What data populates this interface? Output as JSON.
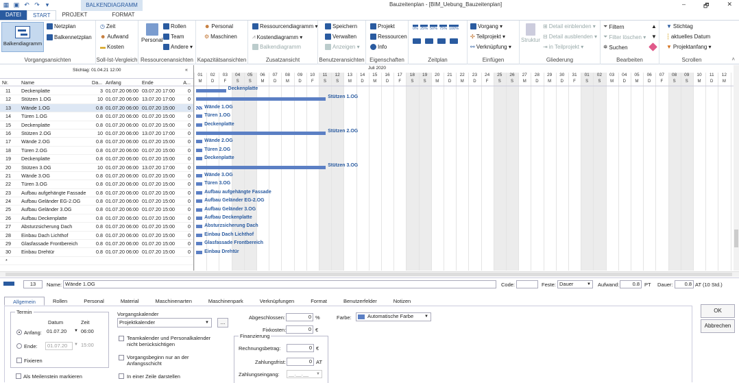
{
  "window": {
    "title": "Bauzeitenplan - [BIM_Uebung_Bauzeitenplan]",
    "context_tab": "BALKENDIAGRAMM",
    "minimize": "–",
    "restore": "🗗",
    "close": "✕"
  },
  "tabs": [
    {
      "label": "DATEI"
    },
    {
      "label": "START"
    },
    {
      "label": "PROJEKT"
    },
    {
      "label": "FORMAT"
    }
  ],
  "ribbon": {
    "g1": {
      "label": "Vorgangsansichten",
      "big": "Balkendiagramm",
      "items": [
        "Netzplan",
        "Balkennetzplan"
      ]
    },
    "g2": {
      "label": "Soll-Ist-Vergleich",
      "items": [
        "Zeit",
        "Aufwand",
        "Kosten"
      ]
    },
    "g3": {
      "label": "Ressourcenansichten",
      "big": "Personal",
      "items": [
        "Rollen",
        "Team",
        "Andere ▾"
      ]
    },
    "g4": {
      "label": "Kapazitätsansichten",
      "items": [
        "Personal",
        "Maschinen"
      ]
    },
    "g5": {
      "label": "Zusatzansicht",
      "items": [
        "Ressourcendiagramm ▾",
        "Kostendiagramm ▾",
        "Balkendiagramm"
      ]
    },
    "g6": {
      "label": "Benutzeransichten",
      "items": [
        "Speichern",
        "Verwalten",
        "Anzeigen ▾"
      ]
    },
    "g7": {
      "label": "Eigenschaften",
      "items": [
        "Projekt",
        "Ressourcen",
        "Info"
      ]
    },
    "g8": {
      "label": "Zeitplan",
      "zooms": [
        "0%",
        "25%",
        "50%",
        "75%",
        "100%"
      ]
    },
    "g9": {
      "label": "Einfügen",
      "items": [
        "Vorgang ▾",
        "Teilprojekt ▾",
        "Verknüpfung ▾"
      ]
    },
    "g10": {
      "label": "Gliederung",
      "big": "Struktur",
      "items": [
        "Detail einblenden ▾",
        "Detail ausblenden ▾",
        "in Teilprojekt ▾"
      ]
    },
    "g11": {
      "label": "Bearbeiten",
      "items": [
        "Filtern",
        "Filter löschen ▾",
        "Suchen"
      ]
    },
    "g12": {
      "label": "Scrollen",
      "items": [
        "Stichtag",
        "aktuelles Datum",
        "Projektanfang ▾"
      ]
    }
  },
  "table": {
    "stichtag": "Stichtag: 01.04.21 12:00",
    "collapse": "«",
    "columns": [
      "Nr.",
      "Name",
      "Da...",
      "Anfang",
      "Ende",
      "A..."
    ],
    "rows": [
      {
        "nr": "11",
        "name": "Deckenplatte",
        "dau": "3",
        "anf": "01.07.20 06:00",
        "end": "03.07.20 17:00",
        "a": "0"
      },
      {
        "nr": "12",
        "name": "Stützen 1.OG",
        "dau": "10",
        "anf": "01.07.20 06:00",
        "end": "13.07.20 17:00",
        "a": "0"
      },
      {
        "nr": "13",
        "name": "Wände 1.OG",
        "dau": "0.8",
        "anf": "01.07.20 06:00",
        "end": "01.07.20 15:00",
        "a": "0"
      },
      {
        "nr": "14",
        "name": "Türen 1.OG",
        "dau": "0.8",
        "anf": "01.07.20 06:00",
        "end": "01.07.20 15:00",
        "a": "0"
      },
      {
        "nr": "15",
        "name": "Deckenplatte",
        "dau": "0.8",
        "anf": "01.07.20 06:00",
        "end": "01.07.20 15:00",
        "a": "0"
      },
      {
        "nr": "16",
        "name": "Stützen 2.OG",
        "dau": "10",
        "anf": "01.07.20 06:00",
        "end": "13.07.20 17:00",
        "a": "0"
      },
      {
        "nr": "17",
        "name": "Wände 2.OG",
        "dau": "0.8",
        "anf": "01.07.20 06:00",
        "end": "01.07.20 15:00",
        "a": "0"
      },
      {
        "nr": "18",
        "name": "Türen 2.OG",
        "dau": "0.8",
        "anf": "01.07.20 06:00",
        "end": "01.07.20 15:00",
        "a": "0"
      },
      {
        "nr": "19",
        "name": "Deckenplatte",
        "dau": "0.8",
        "anf": "01.07.20 06:00",
        "end": "01.07.20 15:00",
        "a": "0"
      },
      {
        "nr": "20",
        "name": "Stützen 3.OG",
        "dau": "10",
        "anf": "01.07.20 06:00",
        "end": "13.07.20 17:00",
        "a": "0"
      },
      {
        "nr": "21",
        "name": "Wände 3.OG",
        "dau": "0.8",
        "anf": "01.07.20 06:00",
        "end": "01.07.20 15:00",
        "a": "0"
      },
      {
        "nr": "22",
        "name": "Türen 3.OG",
        "dau": "0.8",
        "anf": "01.07.20 06:00",
        "end": "01.07.20 15:00",
        "a": "0"
      },
      {
        "nr": "23",
        "name": "Aufbau aufgehängte Fassade",
        "dau": "0.8",
        "anf": "01.07.20 06:00",
        "end": "01.07.20 15:00",
        "a": "0"
      },
      {
        "nr": "24",
        "name": "Aufbau Geländer EG-2.OG",
        "dau": "0.8",
        "anf": "01.07.20 06:00",
        "end": "01.07.20 15:00",
        "a": "0"
      },
      {
        "nr": "25",
        "name": "Aufbau Geländer 3.OG",
        "dau": "0.8",
        "anf": "01.07.20 06:00",
        "end": "01.07.20 15:00",
        "a": "0"
      },
      {
        "nr": "26",
        "name": "Aufbau Deckenplatte",
        "dau": "0.8",
        "anf": "01.07.20 06:00",
        "end": "01.07.20 15:00",
        "a": "0"
      },
      {
        "nr": "27",
        "name": "Absturzsicherung Dach",
        "dau": "0.8",
        "anf": "01.07.20 06:00",
        "end": "01.07.20 15:00",
        "a": "0"
      },
      {
        "nr": "28",
        "name": "Einbau Dach Lichthof",
        "dau": "0.8",
        "anf": "01.07.20 06:00",
        "end": "01.07.20 15:00",
        "a": "0"
      },
      {
        "nr": "29",
        "name": "Glasfassade Frontbereich",
        "dau": "0.8",
        "anf": "01.07.20 06:00",
        "end": "01.07.20 15:00",
        "a": "0"
      },
      {
        "nr": "30",
        "name": "Einbau Drehtür",
        "dau": "0.8",
        "anf": "01.07.20 06:00",
        "end": "01.07.20 15:00",
        "a": "0"
      },
      {
        "nr": "*",
        "name": "",
        "dau": "",
        "anf": "",
        "end": "",
        "a": ""
      }
    ]
  },
  "gantt": {
    "month": "Juli 2020",
    "days": [
      "01",
      "02",
      "03",
      "04",
      "05",
      "06",
      "07",
      "08",
      "09",
      "10",
      "11",
      "12",
      "13",
      "14",
      "15",
      "16",
      "17",
      "18",
      "19",
      "20",
      "21",
      "22",
      "23",
      "24",
      "25",
      "26",
      "27",
      "28",
      "29",
      "30",
      "31",
      "01",
      "02",
      "03",
      "04",
      "05",
      "06",
      "07",
      "08",
      "09",
      "10",
      "11",
      "12",
      "13"
    ],
    "weekday_letters": [
      "M",
      "D",
      "F",
      "S",
      "S",
      "M",
      "D",
      "M",
      "D",
      "F",
      "S",
      "S",
      "M",
      "D",
      "M",
      "D",
      "F",
      "S",
      "S",
      "M",
      "D",
      "M",
      "D",
      "F",
      "S",
      "S",
      "M",
      "D",
      "M",
      "D",
      "F",
      "S",
      "S",
      "M",
      "D",
      "M",
      "D",
      "F",
      "S",
      "S",
      "M",
      "D",
      "M",
      "D"
    ],
    "weekend_indices": [
      3,
      4,
      10,
      11,
      17,
      18,
      24,
      25,
      31,
      32,
      38,
      39
    ],
    "bars": [
      {
        "label": "Deckenplatte",
        "start_day": 0,
        "duration_days": 2.4
      },
      {
        "label": "Stützen 1.OG",
        "start_day": 0,
        "duration_days": 10.4
      },
      {
        "label": "Wände 1.OG",
        "start_day": 0,
        "duration_days": 0.5
      },
      {
        "label": "Türen 1.OG",
        "start_day": 0,
        "duration_days": 0.5
      },
      {
        "label": "Deckenplatte",
        "start_day": 0,
        "duration_days": 0.5
      },
      {
        "label": "Stützen 2.OG",
        "start_day": 0,
        "duration_days": 10.4
      },
      {
        "label": "Wände 2.OG",
        "start_day": 0,
        "duration_days": 0.5
      },
      {
        "label": "Türen 2.OG",
        "start_day": 0,
        "duration_days": 0.5
      },
      {
        "label": "Deckenplatte",
        "start_day": 0,
        "duration_days": 0.5
      },
      {
        "label": "Stützen 3.OG",
        "start_day": 0,
        "duration_days": 10.4
      },
      {
        "label": "Wände 3.OG",
        "start_day": 0,
        "duration_days": 0.5
      },
      {
        "label": "Türen 3.OG",
        "start_day": 0,
        "duration_days": 0.5
      },
      {
        "label": "Aufbau aufgehängte Fassade",
        "start_day": 0,
        "duration_days": 0.5
      },
      {
        "label": "Aufbau Geländer EG-2.OG",
        "start_day": 0,
        "duration_days": 0.5
      },
      {
        "label": "Aufbau Geländer 3.OG",
        "start_day": 0,
        "duration_days": 0.5
      },
      {
        "label": "Aufbau Deckenplatte",
        "start_day": 0,
        "duration_days": 0.5
      },
      {
        "label": "Absturzsicherung Dach",
        "start_day": 0,
        "duration_days": 0.5
      },
      {
        "label": "Einbau Dach Lichthof",
        "start_day": 0,
        "duration_days": 0.5
      },
      {
        "label": "Glasfassade Frontbereich",
        "start_day": 0,
        "duration_days": 0.5
      },
      {
        "label": "Einbau Drehtür",
        "start_day": 0,
        "duration_days": 0.5
      }
    ]
  },
  "detail": {
    "nr": "13",
    "name_label": "Name:",
    "name": "Wände 1.OG",
    "code_label": "Code:",
    "code": "",
    "feste_label": "Feste:",
    "feste": "Dauer",
    "aufwand_label": "Aufwand:",
    "aufwand": "0.8",
    "aufwand_unit": "PT",
    "dauer_label": "Dauer:",
    "dauer": "0.8",
    "dauer_unit": "AT (10 Std.)",
    "tabs": [
      "Allgemein",
      "Rollen",
      "Personal",
      "Material",
      "Maschinenarten",
      "Maschinenpark",
      "Verknüpfungen",
      "Format",
      "Benutzerfelder",
      "Notizen"
    ],
    "termin": "Termin",
    "datum": "Datum",
    "zeit": "Zeit",
    "anfang_label": "Anfang:",
    "anfang_datum": "01.07.20",
    "anfang_zeit": "06:00",
    "ende_label": "Ende:",
    "ende_datum": "01.07.20",
    "ende_zeit": "15:00",
    "fixieren": "Fixieren",
    "meilenstein": "Als Meilenstein markieren",
    "kalender_label": "Vorgangskalender",
    "kalender": "Projektkalender",
    "kalender_btn": "...",
    "cb1": "Teamkalender und Personalkalender nicht berücksichtigen",
    "cb2": "Vorgangsbeginn nur an der Anfangsschicht",
    "cb3": "In einer Zeile darstellen",
    "abgeschlossen_label": "Abgeschlossen:",
    "abgeschlossen": "0",
    "abgeschlossen_unit": "%",
    "fixkosten_label": "Fixkosten:",
    "fixkosten": "0",
    "fixkosten_unit": "€",
    "finanzierung": "Finanzierung",
    "rechnung_label": "Rechnungsbetrag:",
    "rechnung": "0",
    "rechnung_unit": "€",
    "zahlungsfrist_label": "Zahlungsfrist:",
    "zahlungsfrist": "0",
    "zahlungsfrist_unit": "AT",
    "zahlungseingang_label": "Zahlungseingang:",
    "zahlungseingang": "__.__.__",
    "farbe_label": "Farbe:",
    "farbe": "Automatische Farbe",
    "ok": "OK",
    "abbrechen": "Abbrechen"
  },
  "colors": {
    "accent": "#2a5ba0",
    "bar": "#5b7fc4",
    "selected": "#dde7f4"
  }
}
